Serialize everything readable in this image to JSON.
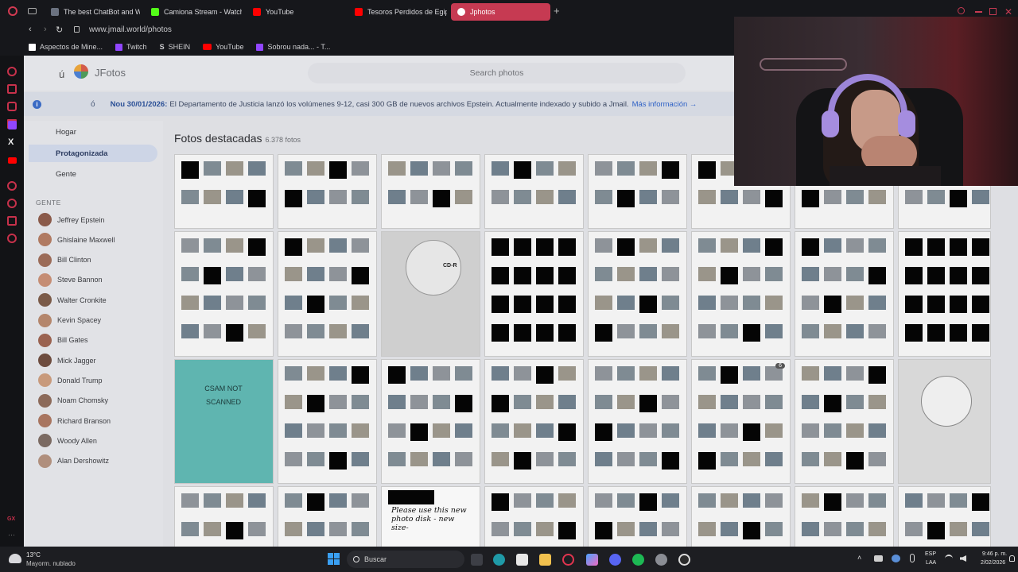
{
  "browser": {
    "tabs": [
      {
        "label": "The best ChatBot and Wid",
        "color": "#4b5563"
      },
      {
        "label": "Camiona Stream - Watch",
        "color": "#53fc18"
      },
      {
        "label": "YouTube",
        "color": "#ff0000"
      },
      {
        "label": "Tesoros Perdidos de Egip",
        "color": "#ff0000"
      },
      {
        "label": "Jphotos",
        "color": "#c63a52"
      }
    ],
    "url": "www.jmail.world/photos",
    "bookmarks": [
      "Aspectos de Mine...",
      "Twitch",
      "SHEIN",
      "YouTube",
      "Sobrou nada... - T..."
    ]
  },
  "app": {
    "logo_prefix": "ú",
    "title": "JFotos",
    "search_placeholder": "Search photos"
  },
  "banner": {
    "date": "Nou 30/01/2026:",
    "text": "El Departamento de Justicia lanzó los volúmenes 9-12, casi 300 GB de nuevos archivos Epstein. Actualmente indexado y subido a Jmail.",
    "link": "Más información →"
  },
  "sidebar": {
    "nav": [
      "Hogar",
      "Protagonizada",
      "Gente"
    ],
    "people_heading": "GENTE",
    "people": [
      "Jeffrey Epstein",
      "Ghislaine Maxwell",
      "Bill Clinton",
      "Steve Bannon",
      "Walter Cronkite",
      "Kevin Spacey",
      "Bill Gates",
      "Mick Jagger",
      "Donald Trump",
      "Noam Chomsky",
      "Richard Branson",
      "Woody Allen",
      "Alan Dershowitz"
    ]
  },
  "main": {
    "heading": "Fotos destacadas",
    "count": "6.378 fotos",
    "tile_text": {
      "csam": "CSAM NOT SCANNED",
      "cd_label": "CD-R",
      "note": "Please use this new photo disk - new size-",
      "badge": "6"
    }
  },
  "taskbar": {
    "weather_temp": "13°C",
    "weather_desc": "Mayorm. nublado",
    "search": "Buscar",
    "lang_top": "ESP",
    "lang_bottom": "LAA",
    "time": "9:46 p. m.",
    "date": "2/02/2026"
  }
}
